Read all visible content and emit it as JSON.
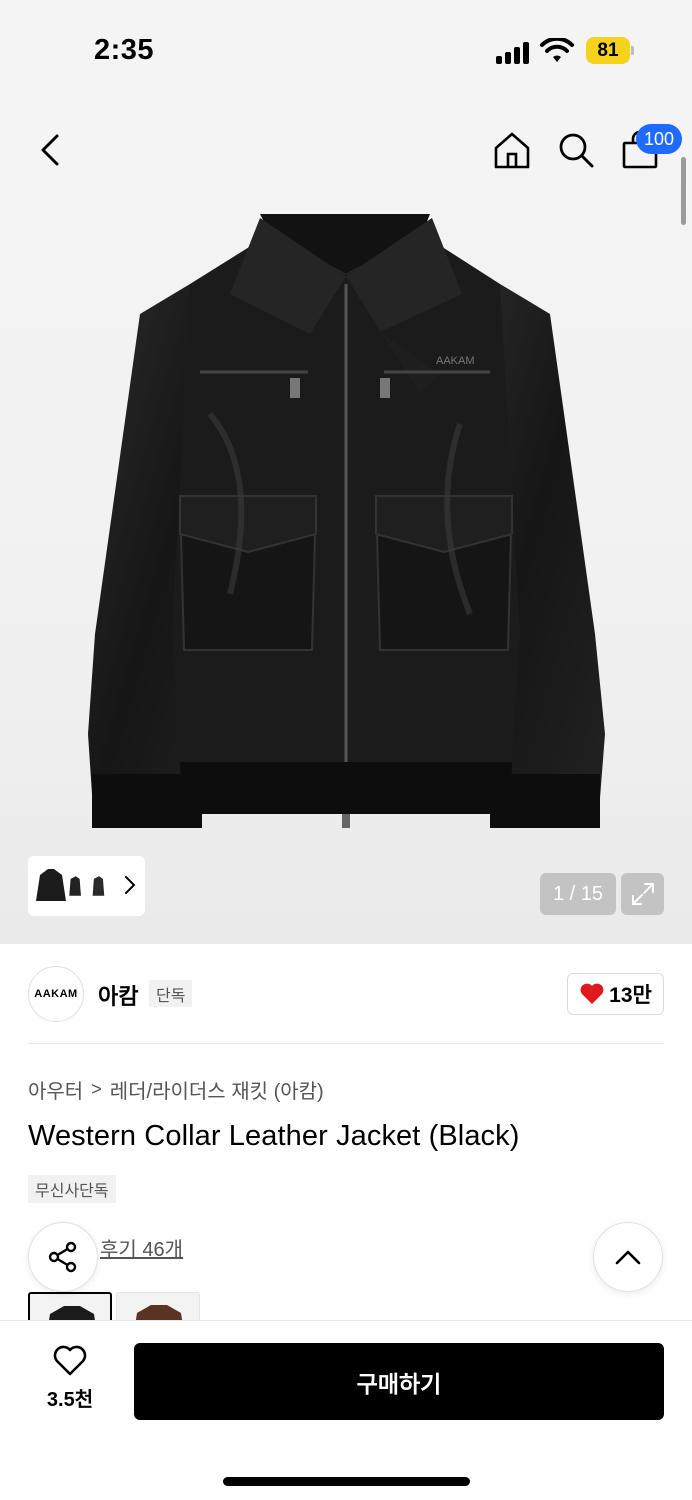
{
  "status_bar": {
    "time": "2:35",
    "battery": "81"
  },
  "header": {
    "cart_count": "100"
  },
  "gallery": {
    "counter": "1 / 15",
    "jacket_brand_mark": "AAKAM",
    "colors": {
      "accent_badge": "#1f6bff",
      "background": "#f3f3f3"
    }
  },
  "brand": {
    "logo_text": "AAKAM",
    "name": "아캄",
    "tag": "단독",
    "likes": "13만",
    "heart_color": "#e0191f"
  },
  "breadcrumb": {
    "parent": "아우터",
    "separator": ">",
    "current": "레더/라이더스 재킷 (아캄)"
  },
  "product": {
    "title": "Western Collar Leather Jacket (Black)",
    "exclusive_tag": "무신사단독",
    "reviews": "후기 46개"
  },
  "bottom_bar": {
    "wish_count": "3.5천",
    "buy_label": "구매하기"
  }
}
